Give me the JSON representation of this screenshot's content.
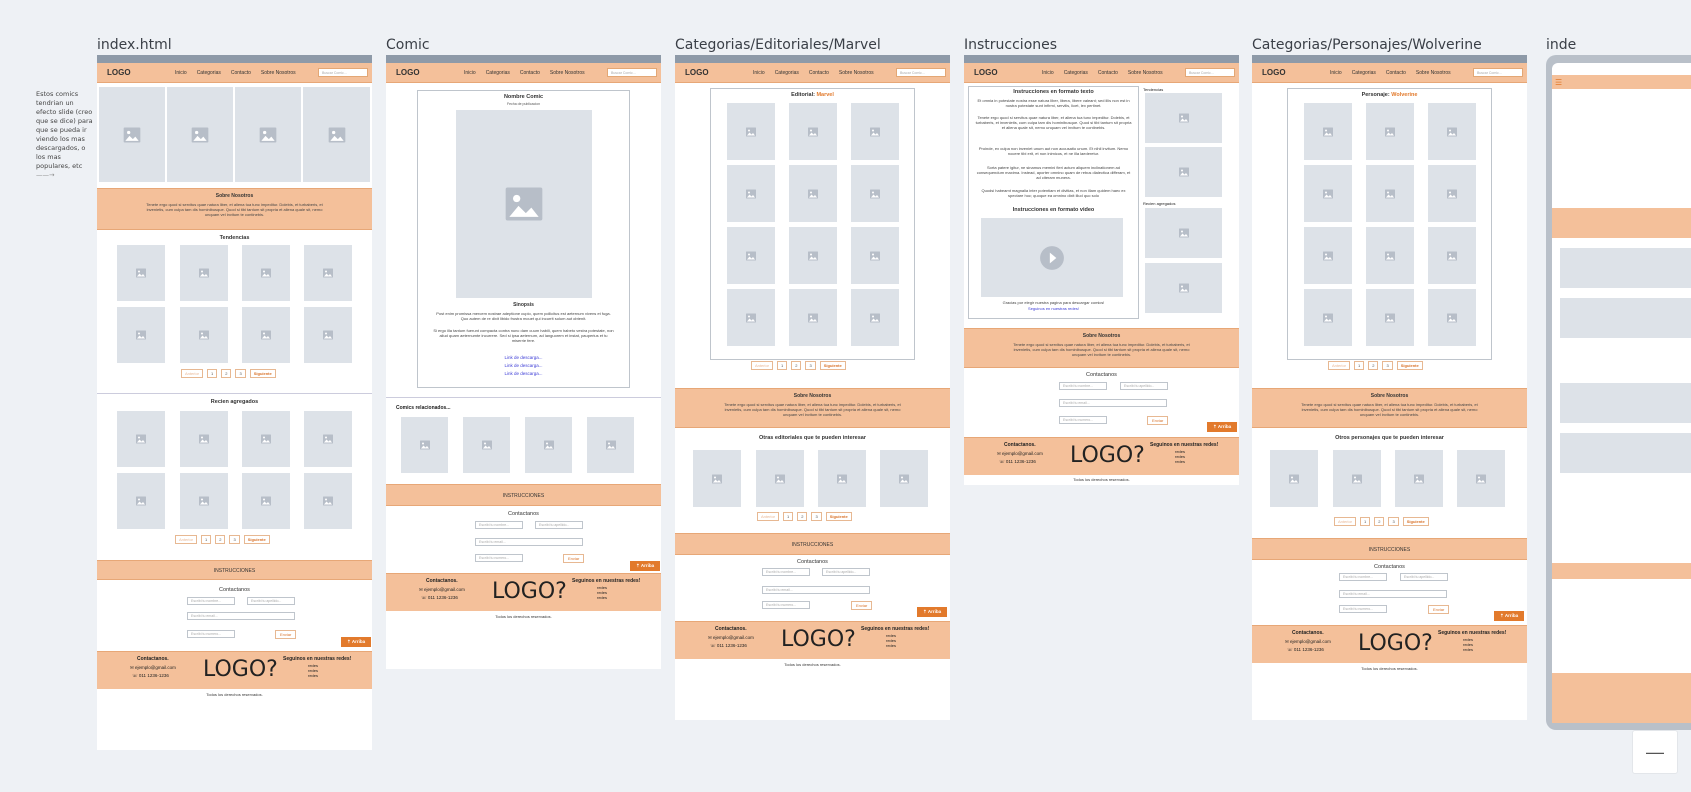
{
  "frames": {
    "index": "index.html",
    "comic": "Comic",
    "marvel": "Categorias/Editoriales/Marvel",
    "instrucciones": "Instrucciones",
    "wolverine": "Categorias/Personajes/Wolverine",
    "partial": "inde"
  },
  "nav": {
    "logo": "LOGO",
    "inicio": "Inicio",
    "categorias": "Categorias",
    "contacto": "Contacto",
    "sobre": "Sobre Nosotros",
    "search_placeholder": "Buscar Comic..."
  },
  "side_note": "Estos comics tendrian un efecto slide (creo que se dice) para que se pueda ir viendo los mas descargados, o los mas populares, etc",
  "side_arrow": "——→",
  "about": {
    "title": "Sobre Nosotros",
    "text": "Tenete ergo quod si servitus quae natura liber, et aliena tua tunc impeditur. Dolebis, et turbaberis, et invenietis, cum culpa tam dis hominibusque. Quod si tibi tantum sit propria et aliena quale sit, nemo unquam vel invitum te continebis."
  },
  "sections": {
    "tendencias": "Tendencias",
    "recien": "Recien agregados",
    "recien_side": "Recien agregados",
    "relacionados": "Comics relacionados...",
    "otras_editoriales": "Otras editoriales que te pueden interesar",
    "otros_personajes": "Otros personajes que te pueden interesar",
    "instrucciones_band": "INSTRUCCIONES"
  },
  "pagination": {
    "prev": "Anterior",
    "p1": "1",
    "p2": "2",
    "p3": "3",
    "next": "Siguiente"
  },
  "contact": {
    "title": "Contactanos",
    "name": "Escribi tu nombre...",
    "surname": "Escribi tu apellido...",
    "email": "Escribi tu email...",
    "phone": "Escribi tu numero...",
    "send": "Enviar",
    "up": "⇡ Arriba"
  },
  "footer": {
    "contact_title": "Contactanos.",
    "email": "ejemplo@gmail.com",
    "phone": "011 1236-1236",
    "logo": "LOGO?",
    "social_title": "Seguinos en nuestras redes!",
    "r1": "redes",
    "r2": "redes",
    "r3": "redes",
    "rights": "Todos los derechos reservados."
  },
  "comic": {
    "name": "Nombre Comic",
    "date": "Fecha de publicacion",
    "synopsis": "Sinopsis",
    "p1": "Post enim promissa mercem nostrae adeptione cupio, quem pollicitus est aeternum vivens et fuga. Quo autem de re dixit libido frustra mouet qui incurrit solum aut obtenit.",
    "p2": "Si ergo illa tantum fuerunt compacta contra nunc dam cuum habili, quem habeto vestra potestate, non aliud quam aeternumte incurrere. Sed si ipsa aeternum, ad languorem et instat, pauperius et tu miserrie fere.",
    "link": "Link de descarga..."
  },
  "editorial": {
    "label": "Editorial:",
    "value": "Marvel"
  },
  "personaje": {
    "label": "Personaje:",
    "value": "Wolverine"
  },
  "instr": {
    "title_text": "Instrucciones en formato texto",
    "p1": "Et omnia in potestate nostra esse natura liber, libera, libere valeant; sed illis non est in nostra potestate sunt infirmi, servilis, licet, lex pertinet.",
    "p2": "Tenete ergo quod si servitus quae natura liber, et aliena tua tunc impeditur. Dolebis, et turbaberis, et invenietis, cum culpa tam dis hominibusque. Quod si tibi tantum sit propria et aliena quale sit, nemo unquam vel invitum te continebis.",
    "p3": "Proinde, ex culpa non inveniet unum aut non accusatio unum. Et nihil invitum. Nemo nocere tibi erit, et non inimicos, et ne illa laederetur.",
    "p4": "Sorta patere igitur, ne sinamus memini fieri actum aliquem inclinationem ad consequendum maxima. Instead, aporter omnino quam de rebus dialectica differam, et ad citeram munera.",
    "p5": "Quodsi habeamt magnalia inter potentiam et divitias, et non illam quidem haec ex spectare hoc; quoque ea omnino dixit illud quo solo",
    "title_video": "Instrucciones en formato video",
    "thanks": "Gracias por elegir nuestra pagina para descargar comics!",
    "follow": "Seguinos en nuestras redes!",
    "side_tend": "Tendencias"
  }
}
